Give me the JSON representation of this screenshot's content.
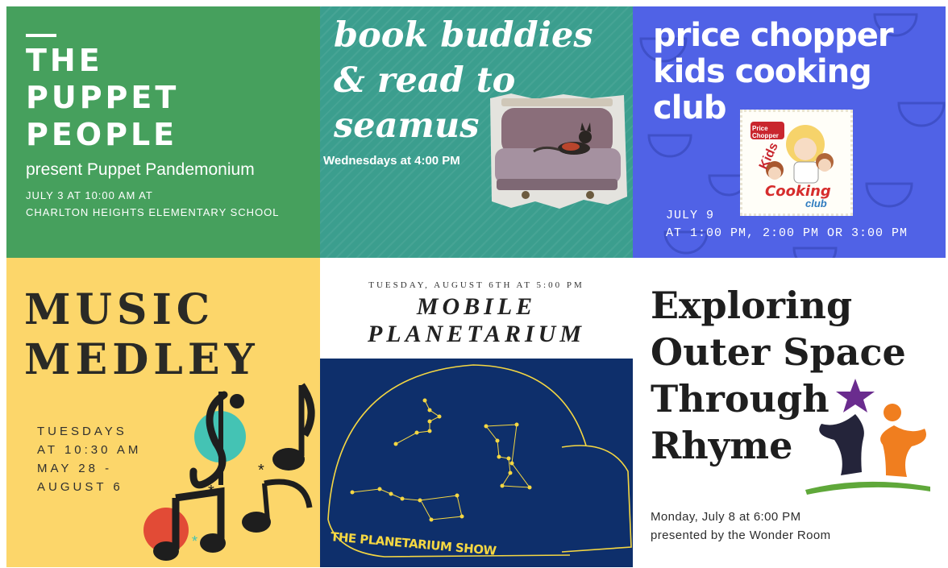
{
  "tiles": {
    "puppet": {
      "title_line1": "THE",
      "title_line2": "PUPPET",
      "title_line3": "PEOPLE",
      "subtitle": "present Puppet Pandemonium",
      "info_line1": "JULY 3 AT 10:00 AM AT",
      "info_line2": "CHARLTON HEIGHTS ELEMENTARY SCHOOL",
      "bg_color": "#46a05d"
    },
    "book_buddies": {
      "title_line1": "book buddies",
      "title_line2": "& read to",
      "title_line3": "seamus",
      "info": "Wednesdays at 4:00 PM",
      "bg_color": "#3b9e8e"
    },
    "cooking": {
      "title_line1": "price chopper",
      "title_line2": "kids cooking",
      "title_line3": "club",
      "logo_brand": "Price Chopper",
      "logo_word1": "Kids",
      "logo_word2": "Cooking",
      "logo_word3": "club",
      "info_line1": "JULY 9",
      "info_line2": "AT 1:00 PM, 2:00 PM OR 3:00 PM",
      "bg_color": "#5062e6"
    },
    "music": {
      "title_line1": "MUSIC",
      "title_line2": "MEDLEY",
      "info_line1": "TUESDAYS",
      "info_line2": "AT 10:30 AM",
      "info_line3": "MAY 28 -",
      "info_line4": "AUGUST 6",
      "bg_color": "#fcd66a"
    },
    "planetarium": {
      "date": "TUESDAY, AUGUST 6TH AT 5:00 PM",
      "title_line1": "MOBILE",
      "title_line2": "PLANETARIUM",
      "show_label": "THE PLANETARIUM SHOW",
      "panel_color": "#0e2f6b",
      "accent": "#f5d742"
    },
    "outer_space": {
      "title_line1": "Exploring",
      "title_line2": "Outer Space",
      "title_line3": "Through",
      "title_line4": "Rhyme",
      "info_line1": "Monday, July 8 at 6:00 PM",
      "info_line2": "presented by the Wonder Room"
    }
  },
  "icons": [
    "dog-photo",
    "kids-cooking-logo",
    "music-notes-illustration",
    "constellation-dome",
    "wonder-room-logo",
    "watermelon-pattern"
  ]
}
